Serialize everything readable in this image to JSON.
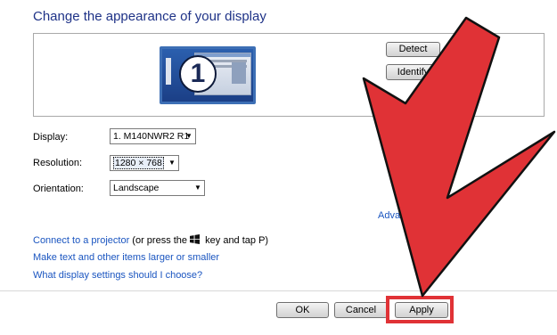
{
  "page": {
    "title": "Change the appearance of your display"
  },
  "preview": {
    "monitor_number": "1",
    "detect_label": "Detect",
    "identify_label": "Identify"
  },
  "settings": {
    "display": {
      "label": "Display:",
      "value": "1. M140NWR2 R1"
    },
    "resolution": {
      "label": "Resolution:",
      "value": "1280 × 768"
    },
    "orientation": {
      "label": "Orientation:",
      "value": "Landscape"
    }
  },
  "advanced_link_partial": "Adva",
  "links": {
    "projector": "Connect to a projector",
    "projector_suffix_a": " (or press the ",
    "projector_suffix_b": " key and tap P)",
    "text_size": "Make text and other items larger or smaller",
    "which_settings": "What display settings should I choose?"
  },
  "footer": {
    "ok_label": "OK",
    "cancel_label": "Cancel",
    "apply_label": "Apply"
  },
  "icons": {
    "windows_key": "windows-logo-icon",
    "dropdown": "chevron-down-icon"
  },
  "colors": {
    "title": "#1e3287",
    "link": "#1a55c0",
    "highlight_arrow": "#e03236"
  }
}
